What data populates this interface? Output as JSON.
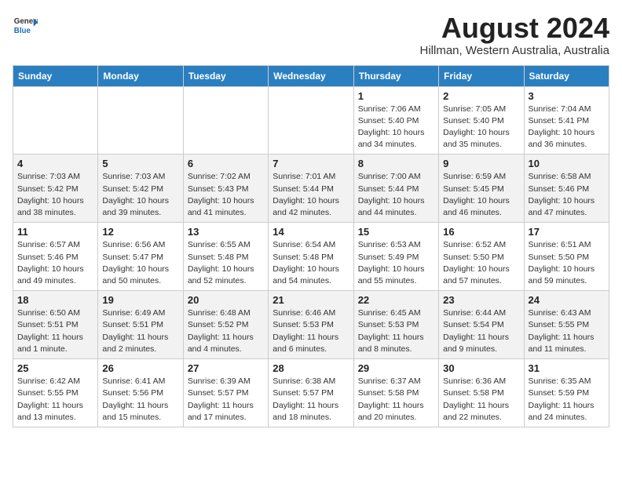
{
  "header": {
    "logo_line1": "General",
    "logo_line2": "Blue",
    "month_year": "August 2024",
    "location": "Hillman, Western Australia, Australia"
  },
  "weekdays": [
    "Sunday",
    "Monday",
    "Tuesday",
    "Wednesday",
    "Thursday",
    "Friday",
    "Saturday"
  ],
  "weeks": [
    [
      {
        "day": "",
        "info": ""
      },
      {
        "day": "",
        "info": ""
      },
      {
        "day": "",
        "info": ""
      },
      {
        "day": "",
        "info": ""
      },
      {
        "day": "1",
        "info": "Sunrise: 7:06 AM\nSunset: 5:40 PM\nDaylight: 10 hours\nand 34 minutes."
      },
      {
        "day": "2",
        "info": "Sunrise: 7:05 AM\nSunset: 5:40 PM\nDaylight: 10 hours\nand 35 minutes."
      },
      {
        "day": "3",
        "info": "Sunrise: 7:04 AM\nSunset: 5:41 PM\nDaylight: 10 hours\nand 36 minutes."
      }
    ],
    [
      {
        "day": "4",
        "info": "Sunrise: 7:03 AM\nSunset: 5:42 PM\nDaylight: 10 hours\nand 38 minutes."
      },
      {
        "day": "5",
        "info": "Sunrise: 7:03 AM\nSunset: 5:42 PM\nDaylight: 10 hours\nand 39 minutes."
      },
      {
        "day": "6",
        "info": "Sunrise: 7:02 AM\nSunset: 5:43 PM\nDaylight: 10 hours\nand 41 minutes."
      },
      {
        "day": "7",
        "info": "Sunrise: 7:01 AM\nSunset: 5:44 PM\nDaylight: 10 hours\nand 42 minutes."
      },
      {
        "day": "8",
        "info": "Sunrise: 7:00 AM\nSunset: 5:44 PM\nDaylight: 10 hours\nand 44 minutes."
      },
      {
        "day": "9",
        "info": "Sunrise: 6:59 AM\nSunset: 5:45 PM\nDaylight: 10 hours\nand 46 minutes."
      },
      {
        "day": "10",
        "info": "Sunrise: 6:58 AM\nSunset: 5:46 PM\nDaylight: 10 hours\nand 47 minutes."
      }
    ],
    [
      {
        "day": "11",
        "info": "Sunrise: 6:57 AM\nSunset: 5:46 PM\nDaylight: 10 hours\nand 49 minutes."
      },
      {
        "day": "12",
        "info": "Sunrise: 6:56 AM\nSunset: 5:47 PM\nDaylight: 10 hours\nand 50 minutes."
      },
      {
        "day": "13",
        "info": "Sunrise: 6:55 AM\nSunset: 5:48 PM\nDaylight: 10 hours\nand 52 minutes."
      },
      {
        "day": "14",
        "info": "Sunrise: 6:54 AM\nSunset: 5:48 PM\nDaylight: 10 hours\nand 54 minutes."
      },
      {
        "day": "15",
        "info": "Sunrise: 6:53 AM\nSunset: 5:49 PM\nDaylight: 10 hours\nand 55 minutes."
      },
      {
        "day": "16",
        "info": "Sunrise: 6:52 AM\nSunset: 5:50 PM\nDaylight: 10 hours\nand 57 minutes."
      },
      {
        "day": "17",
        "info": "Sunrise: 6:51 AM\nSunset: 5:50 PM\nDaylight: 10 hours\nand 59 minutes."
      }
    ],
    [
      {
        "day": "18",
        "info": "Sunrise: 6:50 AM\nSunset: 5:51 PM\nDaylight: 11 hours\nand 1 minute."
      },
      {
        "day": "19",
        "info": "Sunrise: 6:49 AM\nSunset: 5:51 PM\nDaylight: 11 hours\nand 2 minutes."
      },
      {
        "day": "20",
        "info": "Sunrise: 6:48 AM\nSunset: 5:52 PM\nDaylight: 11 hours\nand 4 minutes."
      },
      {
        "day": "21",
        "info": "Sunrise: 6:46 AM\nSunset: 5:53 PM\nDaylight: 11 hours\nand 6 minutes."
      },
      {
        "day": "22",
        "info": "Sunrise: 6:45 AM\nSunset: 5:53 PM\nDaylight: 11 hours\nand 8 minutes."
      },
      {
        "day": "23",
        "info": "Sunrise: 6:44 AM\nSunset: 5:54 PM\nDaylight: 11 hours\nand 9 minutes."
      },
      {
        "day": "24",
        "info": "Sunrise: 6:43 AM\nSunset: 5:55 PM\nDaylight: 11 hours\nand 11 minutes."
      }
    ],
    [
      {
        "day": "25",
        "info": "Sunrise: 6:42 AM\nSunset: 5:55 PM\nDaylight: 11 hours\nand 13 minutes."
      },
      {
        "day": "26",
        "info": "Sunrise: 6:41 AM\nSunset: 5:56 PM\nDaylight: 11 hours\nand 15 minutes."
      },
      {
        "day": "27",
        "info": "Sunrise: 6:39 AM\nSunset: 5:57 PM\nDaylight: 11 hours\nand 17 minutes."
      },
      {
        "day": "28",
        "info": "Sunrise: 6:38 AM\nSunset: 5:57 PM\nDaylight: 11 hours\nand 18 minutes."
      },
      {
        "day": "29",
        "info": "Sunrise: 6:37 AM\nSunset: 5:58 PM\nDaylight: 11 hours\nand 20 minutes."
      },
      {
        "day": "30",
        "info": "Sunrise: 6:36 AM\nSunset: 5:58 PM\nDaylight: 11 hours\nand 22 minutes."
      },
      {
        "day": "31",
        "info": "Sunrise: 6:35 AM\nSunset: 5:59 PM\nDaylight: 11 hours\nand 24 minutes."
      }
    ]
  ]
}
